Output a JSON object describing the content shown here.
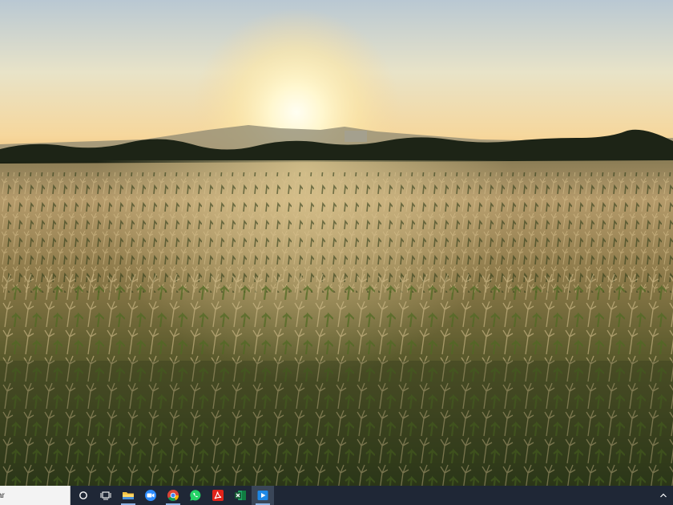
{
  "wallpaper": {
    "description_colors": {
      "sky_top": "#b9c8d3",
      "sky_horizon": "#f6d79c",
      "sun": "#fffbe3",
      "tree_line": "#1d2416",
      "field_far": "#b49a6a",
      "field_near": "#34401c"
    }
  },
  "taskbar": {
    "background": "#1f2736",
    "search": {
      "text": "ar"
    },
    "buttons": [
      {
        "name": "cortana-button",
        "icon": "circle-icon"
      },
      {
        "name": "task-view-button",
        "icon": "task-view-icon"
      },
      {
        "name": "file-explorer-button",
        "icon": "folder-icon",
        "running": true
      },
      {
        "name": "zoom-button",
        "icon": "zoom-camera-icon"
      },
      {
        "name": "chrome-button",
        "icon": "chrome-icon",
        "running": true
      },
      {
        "name": "whatsapp-button",
        "icon": "whatsapp-icon"
      },
      {
        "name": "acrobat-button",
        "icon": "acrobat-icon"
      },
      {
        "name": "excel-button",
        "icon": "excel-icon"
      },
      {
        "name": "media-player-button",
        "icon": "media-player-icon",
        "active": true
      }
    ],
    "tray": {
      "chevron_icon": "chevron-up-icon"
    }
  }
}
